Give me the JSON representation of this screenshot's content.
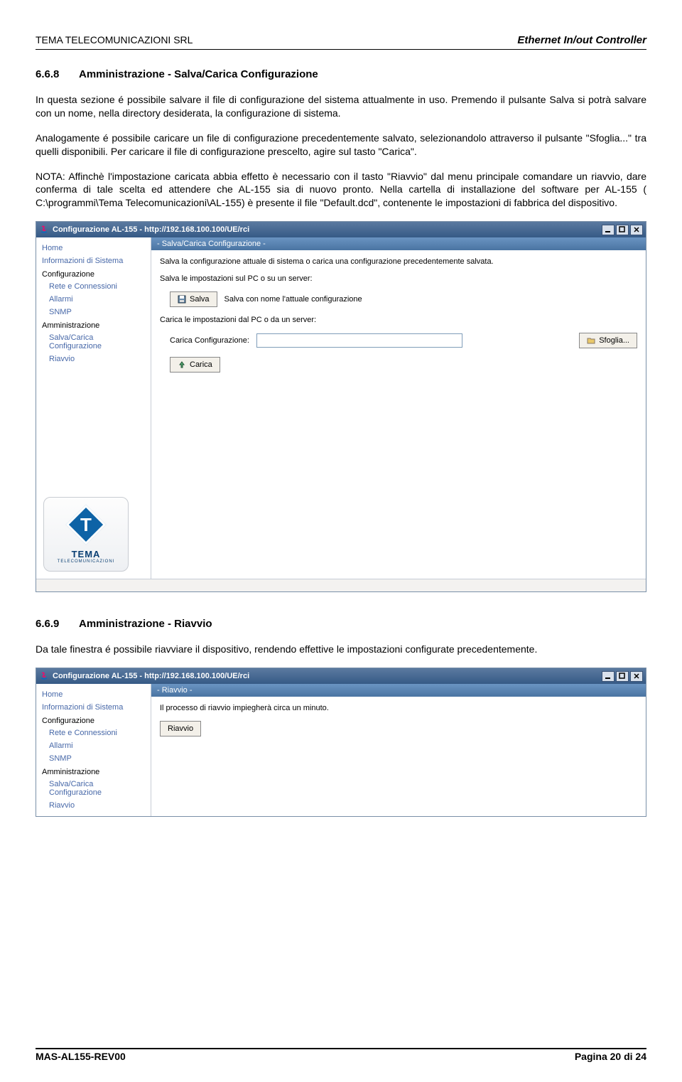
{
  "header": {
    "left": "TEMA TELECOMUNICAZIONI SRL",
    "right": "Ethernet In/out Controller"
  },
  "section1": {
    "num": "6.6.8",
    "title": "Amministrazione - Salva/Carica Configurazione",
    "p1": "In questa sezione é possibile salvare il file di configurazione del sistema attualmente in uso. Premendo il pulsante Salva si potrà salvare con un nome, nella directory desiderata, la configurazione di sistema.",
    "p2": "Analogamente é possibile caricare un file di configurazione precedentemente salvato, selezionandolo attraverso il pulsante \"Sfoglia...\" tra quelli disponibili. Per caricare il file di configurazione prescelto, agire sul tasto \"Carica\".",
    "p3": "NOTA: Affinchè l'impostazione caricata abbia effetto è necessario con il tasto \"Riavvio\" dal menu principale comandare un riavvio, dare conferma di tale scelta ed attendere che AL-155 sia di nuovo pronto. Nella cartella di installazione del software per AL-155 ( C:\\programmi\\Tema Telecomunicazioni\\AL-155) è presente il file \"Default.dcd\", contenente le impostazioni di fabbrica del dispositivo."
  },
  "win1": {
    "title": "Configurazione AL-155 - http://192.168.100.100/UE/rci",
    "panel_head": "- Salva/Carica Configurazione -",
    "intro": "Salva la configurazione attuale di sistema o carica una configurazione precedentemente salvata.",
    "save_heading": "Salva le impostazioni sul PC o su un server:",
    "save_btn": "Salva",
    "save_help": "Salva con nome l'attuale configurazione",
    "load_heading": "Carica le impostazioni dal PC o da un server:",
    "load_label": "Carica Configurazione:",
    "input_value": "",
    "browse_btn": "Sfoglia...",
    "load_btn": "Carica"
  },
  "sidebar": {
    "home": "Home",
    "info": "Informazioni di Sistema",
    "config": "Configurazione",
    "rete": "Rete e Connessioni",
    "allarmi": "Allarmi",
    "snmp": "SNMP",
    "admin": "Amministrazione",
    "salva": "Salva/Carica Configurazione",
    "riavvio": "Riavvio"
  },
  "logo": {
    "brand": "TEMA",
    "sub": "TELECOMUNICAZIONI"
  },
  "section2": {
    "num": "6.6.9",
    "title": "Amministrazione - Riavvio",
    "p1": "Da tale finestra é possibile riavviare il dispositivo, rendendo effettive le impostazioni configurate precedentemente."
  },
  "win2": {
    "title": "Configurazione AL-155 - http://192.168.100.100/UE/rci",
    "panel_head": "- Riavvio -",
    "intro": "Il processo di riavvio impiegherà circa un minuto.",
    "btn": "Riavvio"
  },
  "footer": {
    "left": "MAS-AL155-REV00",
    "right": "Pagina 20 di 24"
  }
}
